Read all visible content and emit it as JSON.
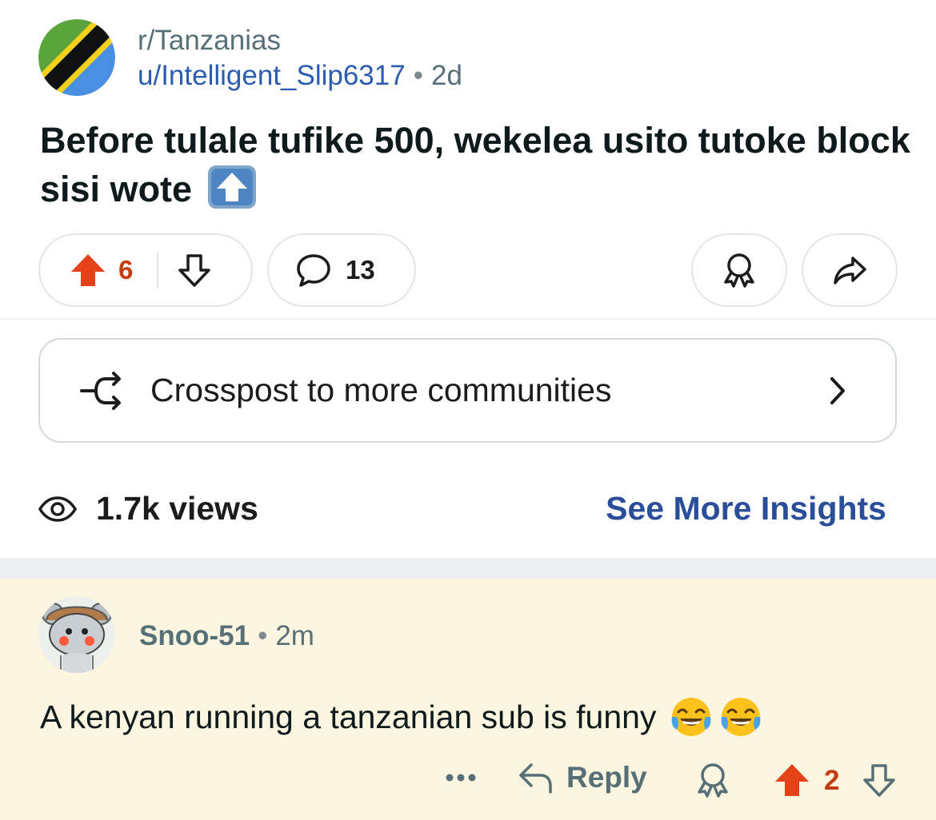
{
  "post": {
    "subreddit": "r/Tanzanias",
    "author": "u/Intelligent_Slip6317",
    "separator": "•",
    "age": "2d",
    "title": "Before tulale tufike 500, wekelea usito tutoke block sisi wote",
    "title_emoji": "up-arrow-emoji",
    "upvotes": "6",
    "comments": "13",
    "crosspost_label": "Crosspost to more communities",
    "views": "1.7k views",
    "insights_label": "See More Insights"
  },
  "comment": {
    "author": "Snoo-51",
    "separator": "•",
    "age": "2m",
    "body": "A kenyan running a tanzanian sub is funny",
    "emojis": [
      "face-with-tears-of-joy",
      "face-with-tears-of-joy"
    ],
    "reply_label": "Reply",
    "score": "2"
  },
  "colors": {
    "upvote": "#e5421a",
    "vote_count": "#c43d0f",
    "link": "#2a5db0",
    "insights": "#2a4e9a",
    "comment_bg": "#fcf6e0"
  }
}
